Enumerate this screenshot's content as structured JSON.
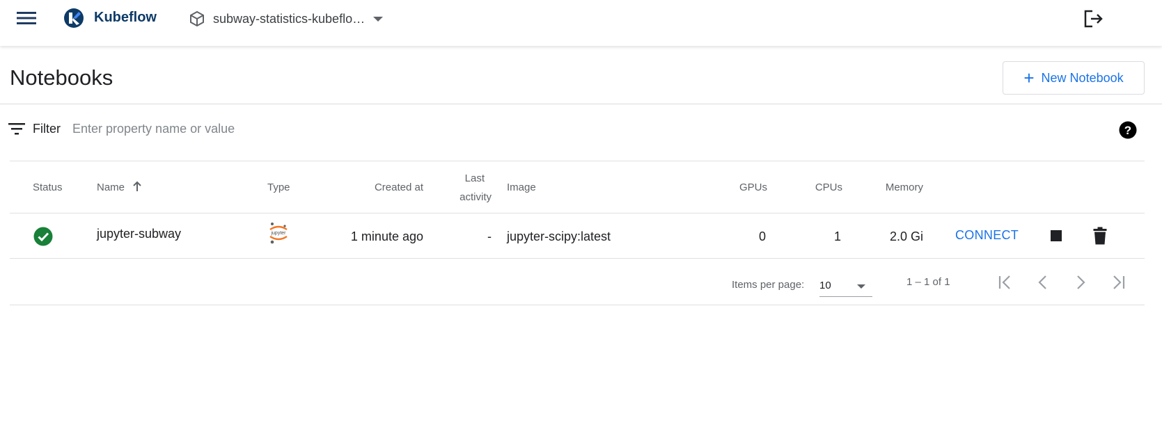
{
  "app": {
    "brand": "Kubeflow",
    "namespace": "subway-statistics-kubeflo…"
  },
  "page": {
    "title": "Notebooks",
    "new_button_label": "New Notebook"
  },
  "filter": {
    "label": "Filter",
    "placeholder": "Enter property name or value"
  },
  "table": {
    "headers": {
      "status": "Status",
      "name": "Name",
      "type": "Type",
      "created_at": "Created at",
      "last_activity_line1": "Last",
      "last_activity_line2": "activity",
      "image": "Image",
      "gpus": "GPUs",
      "cpus": "CPUs",
      "memory": "Memory"
    },
    "sort": {
      "column": "Name",
      "direction": "ascending"
    },
    "rows": [
      {
        "status": "ready",
        "name": "jupyter-subway",
        "type": "jupyter",
        "type_logo_text": "jupyter",
        "created_at": "1 minute ago",
        "last_activity": "-",
        "image": "jupyter-scipy:latest",
        "gpus": "0",
        "cpus": "1",
        "memory": "2.0 Gi",
        "connect_label": "CONNECT"
      }
    ]
  },
  "paginator": {
    "items_per_page_label": "Items per page:",
    "items_per_page_value": "10",
    "range_label": "1 – 1 of 1"
  },
  "icons": {
    "menu": "menu-icon",
    "logo": "kubeflow-logo-icon",
    "namespace": "cube-icon",
    "logout": "logout-icon",
    "filter": "filter-icon",
    "help": "help-icon",
    "status": "check-circle-icon",
    "stop": "stop-icon",
    "delete": "delete-icon"
  },
  "colors": {
    "brand": "#0d3a67",
    "accent": "#1a73e8",
    "status_ok": "#188038",
    "jupyter_orange": "#f37726"
  }
}
